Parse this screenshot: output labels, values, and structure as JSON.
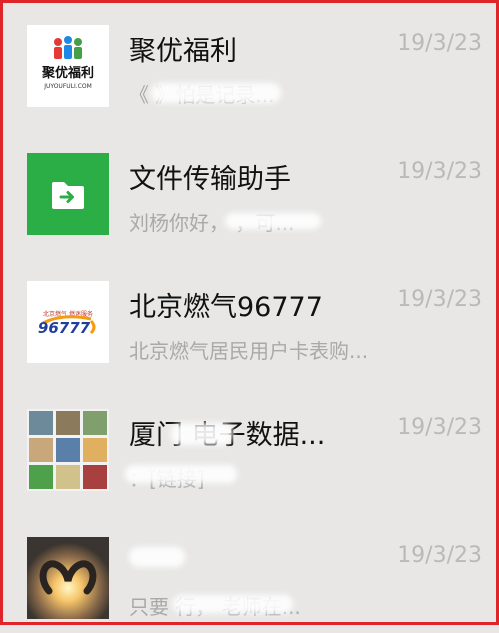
{
  "chats": [
    {
      "name": "聚优福利",
      "date": "19/3/23",
      "preview": "《                》怕是记录...",
      "avatar": {
        "type": "logo",
        "text_cn": "聚优福利",
        "text_en": "JUYOUFULI.COM",
        "icon": "people-logo-icon"
      }
    },
    {
      "name": "文件传输助手",
      "date": "19/3/23",
      "preview": "刘杨你好，              ，可...",
      "avatar": {
        "type": "icon",
        "color": "#2aae45",
        "icon": "folder-transfer-icon"
      }
    },
    {
      "name": "北京燃气96777",
      "date": "19/3/23",
      "preview": "北京燃气居民用户卡表购...",
      "avatar": {
        "type": "logo",
        "text": "96777",
        "tagline": "北京燃气 燃迷服务",
        "icon": "flame-logo-icon"
      }
    },
    {
      "name": "厦门        电子数据...",
      "date": "19/3/23",
      "preview": "              ：[链接]",
      "avatar": {
        "type": "group-grid",
        "icon": "group-avatar-grid"
      }
    },
    {
      "name": "",
      "date": "19/3/23",
      "preview": "只要          行，     老师在...",
      "avatar": {
        "type": "photo",
        "icon": "heart-hands-photo"
      }
    }
  ]
}
